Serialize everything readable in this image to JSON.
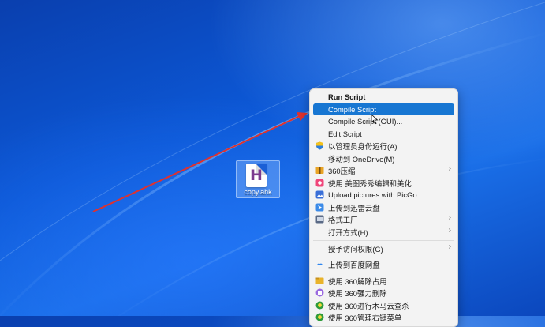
{
  "desktop": {
    "file_icon": {
      "name": "copy.ahk",
      "glyph": "H"
    }
  },
  "context_menu": {
    "items": [
      {
        "label": "Run Script",
        "bold": true
      },
      {
        "label": "Compile Script",
        "selected": true
      },
      {
        "label": "Compile Script (GUI)..."
      },
      {
        "label": "Edit Script"
      },
      {
        "label": "以管理员身份运行(A)",
        "icon": "uac-shield-icon"
      },
      {
        "label": "移动到 OneDrive(M)",
        "icon": "onedrive-icon"
      },
      {
        "label": "360压缩",
        "icon": "360zip-icon",
        "submenu": true
      },
      {
        "label": "使用 美图秀秀编辑和美化",
        "icon": "meitu-icon"
      },
      {
        "label": "Upload pictures with PicGo",
        "icon": "picgo-icon"
      },
      {
        "label": "上传到迅雷云盘",
        "icon": "xunlei-icon"
      },
      {
        "label": "格式工厂",
        "icon": "format-factory-icon",
        "submenu": true
      },
      {
        "label": "打开方式(H)",
        "submenu": true
      },
      {
        "label": "授予访问权限(G)",
        "submenu": true
      },
      {
        "label": "上传到百度网盘",
        "icon": "baidu-netdisk-icon"
      },
      {
        "label": "使用 360解除占用",
        "icon": "360-unlock-icon"
      },
      {
        "label": "使用 360强力删除",
        "icon": "360-delete-icon"
      },
      {
        "label": "使用 360进行木马云查杀",
        "icon": "360-scan-icon"
      },
      {
        "label": "使用 360管理右键菜单",
        "icon": "360-menu-icon"
      }
    ]
  },
  "colors": {
    "selection": "#1776d2",
    "arrow": "#e0312d"
  }
}
